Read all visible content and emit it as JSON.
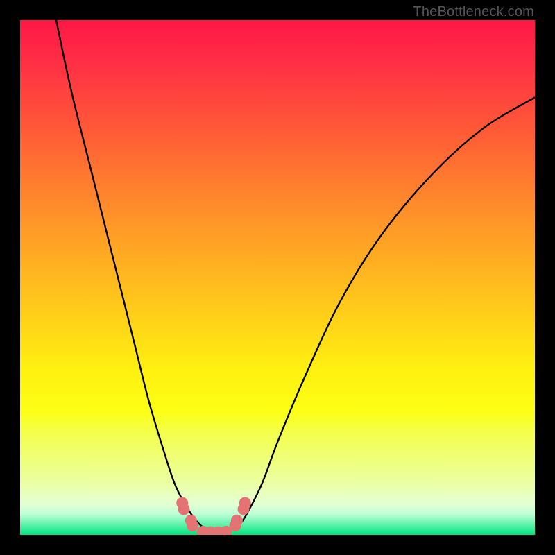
{
  "watermark": "TheBottleneck.com",
  "chart_data": {
    "type": "line",
    "title": "",
    "xlabel": "",
    "ylabel": "",
    "xlim": [
      0,
      100
    ],
    "ylim": [
      0,
      100
    ],
    "series": [
      {
        "name": "left-curve",
        "x": [
          7,
          10,
          14,
          18,
          22,
          25,
          28,
          30,
          32,
          34,
          35.5,
          37
        ],
        "y": [
          100,
          86,
          70,
          54,
          38,
          26,
          16,
          10,
          6,
          3,
          1.5,
          0.5
        ]
      },
      {
        "name": "right-curve",
        "x": [
          42,
          44,
          47,
          50,
          55,
          62,
          70,
          80,
          90,
          100
        ],
        "y": [
          1,
          4,
          10,
          18,
          30,
          45,
          58,
          70,
          79,
          85
        ]
      },
      {
        "name": "bottom-markers",
        "x": [
          31.5,
          31.8,
          33.2,
          33.5,
          35.5,
          37,
          38.5,
          40,
          41.8,
          42.1,
          43.4,
          43.7
        ],
        "y": [
          6.2,
          5.0,
          2.8,
          1.8,
          0.6,
          0.5,
          0.5,
          0.6,
          1.8,
          2.8,
          5.0,
          6.2
        ]
      }
    ],
    "marker_color": "#e57373",
    "curve_color": "#000000",
    "background_gradient": [
      "#ff1846",
      "#ffcb1a",
      "#fcff14",
      "#00e57e"
    ]
  }
}
